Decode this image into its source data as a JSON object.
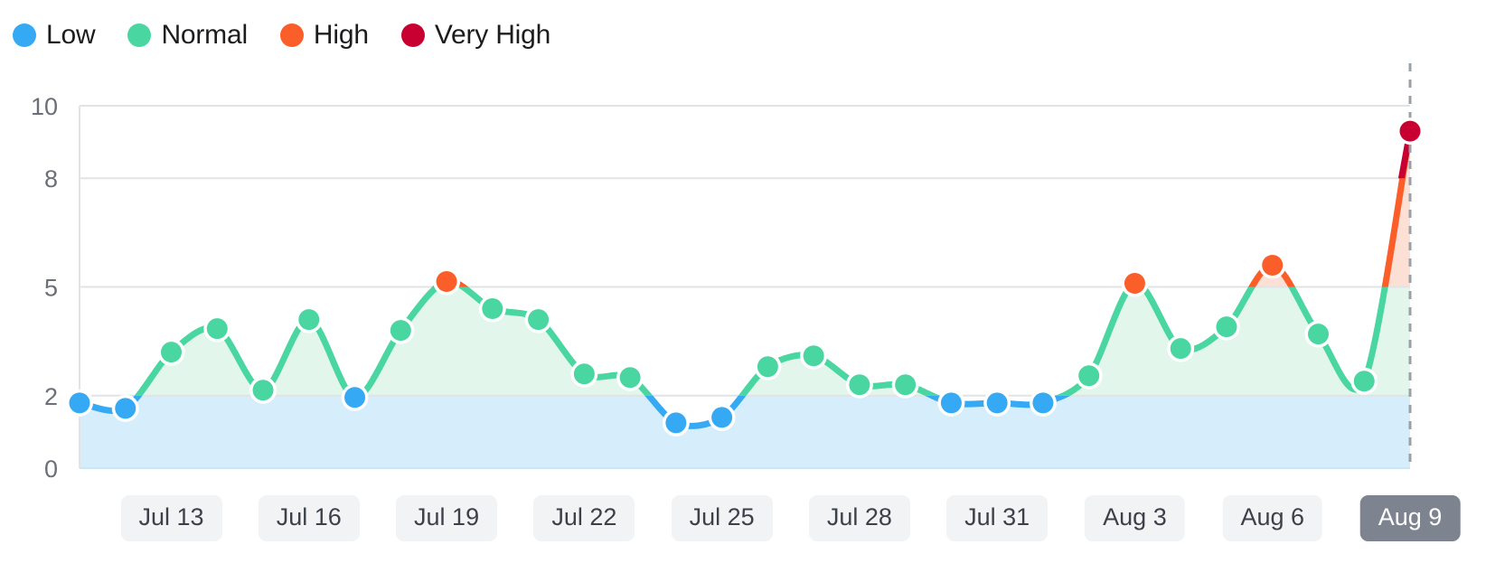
{
  "legend": {
    "items": [
      {
        "label": "Low",
        "color": "#35a9f4",
        "icon": "circle-icon"
      },
      {
        "label": "Normal",
        "color": "#49d6a0",
        "icon": "circle-icon"
      },
      {
        "label": "High",
        "color": "#fb5e28",
        "icon": "circle-icon"
      },
      {
        "label": "Very High",
        "color": "#c80032",
        "icon": "circle-icon"
      }
    ]
  },
  "axis": {
    "y_ticks": [
      "0",
      "2",
      "5",
      "8",
      "10"
    ],
    "x_pill_labels": [
      {
        "label": "Jul 13",
        "selected": false
      },
      {
        "label": "Jul 16",
        "selected": false
      },
      {
        "label": "Jul 19",
        "selected": false
      },
      {
        "label": "Jul 22",
        "selected": false
      },
      {
        "label": "Jul 25",
        "selected": false
      },
      {
        "label": "Jul 28",
        "selected": false
      },
      {
        "label": "Jul 31",
        "selected": false
      },
      {
        "label": "Aug 3",
        "selected": false
      },
      {
        "label": "Aug 6",
        "selected": false
      },
      {
        "label": "Aug 9",
        "selected": true
      }
    ]
  },
  "bands": {
    "low": {
      "from": 0,
      "to": 2,
      "fill": "#d6edfb"
    },
    "normal": {
      "from": 2,
      "to": 5,
      "fill": "#e2f6ec"
    },
    "high": {
      "from": 5,
      "to": 10,
      "fill": "#fce0d6"
    }
  },
  "marker_last": {
    "label": "Aug 9",
    "style": "dashed-vertical-line",
    "color": "#9aa0a6"
  },
  "chart_data": {
    "type": "line",
    "title": "",
    "xlabel": "",
    "ylabel": "",
    "ylim": [
      0,
      10
    ],
    "yticks": [
      0,
      2,
      5,
      8,
      10
    ],
    "grid": true,
    "legend_position": "top-left",
    "thresholds": {
      "low_max": 2,
      "normal_max": 5,
      "high_max": 8
    },
    "x": [
      "Jul 11",
      "Jul 12",
      "Jul 13",
      "Jul 14",
      "Jul 15",
      "Jul 16",
      "Jul 17",
      "Jul 18",
      "Jul 19",
      "Jul 20",
      "Jul 21",
      "Jul 22",
      "Jul 23",
      "Jul 24",
      "Jul 25",
      "Jul 26",
      "Jul 27",
      "Jul 28",
      "Jul 29",
      "Jul 30",
      "Jul 31",
      "Aug 1",
      "Aug 2",
      "Aug 3",
      "Aug 4",
      "Aug 5",
      "Aug 6",
      "Aug 7",
      "Aug 8",
      "Aug 9"
    ],
    "values": [
      1.8,
      1.65,
      3.2,
      3.85,
      2.15,
      4.1,
      1.95,
      3.8,
      5.15,
      4.4,
      4.1,
      2.6,
      2.5,
      1.25,
      1.4,
      2.8,
      3.1,
      2.3,
      2.3,
      1.8,
      1.8,
      1.8,
      2.55,
      5.1,
      3.3,
      3.9,
      5.6,
      3.7,
      2.4,
      9.3
    ],
    "categories_of_point": [
      "Low",
      "Low",
      "Normal",
      "Normal",
      "Normal",
      "Normal",
      "Low",
      "Normal",
      "High",
      "Normal",
      "Normal",
      "Normal",
      "Normal",
      "Low",
      "Low",
      "Normal",
      "Normal",
      "Normal",
      "Normal",
      "Low",
      "Low",
      "Low",
      "Normal",
      "High",
      "Normal",
      "Normal",
      "High",
      "Normal",
      "Normal",
      "Very High"
    ],
    "series": [
      {
        "name": "Reading",
        "values": [
          1.8,
          1.65,
          3.2,
          3.85,
          2.15,
          4.1,
          1.95,
          3.8,
          5.15,
          4.4,
          4.1,
          2.6,
          2.5,
          1.25,
          1.4,
          2.8,
          3.1,
          2.3,
          2.3,
          1.8,
          1.8,
          1.8,
          2.55,
          5.1,
          3.3,
          3.9,
          5.6,
          3.7,
          2.4,
          9.3
        ]
      }
    ],
    "colors": {
      "Low": "#35a9f4",
      "Normal": "#49d6a0",
      "High": "#fb5e28",
      "Very High": "#c80032"
    }
  }
}
